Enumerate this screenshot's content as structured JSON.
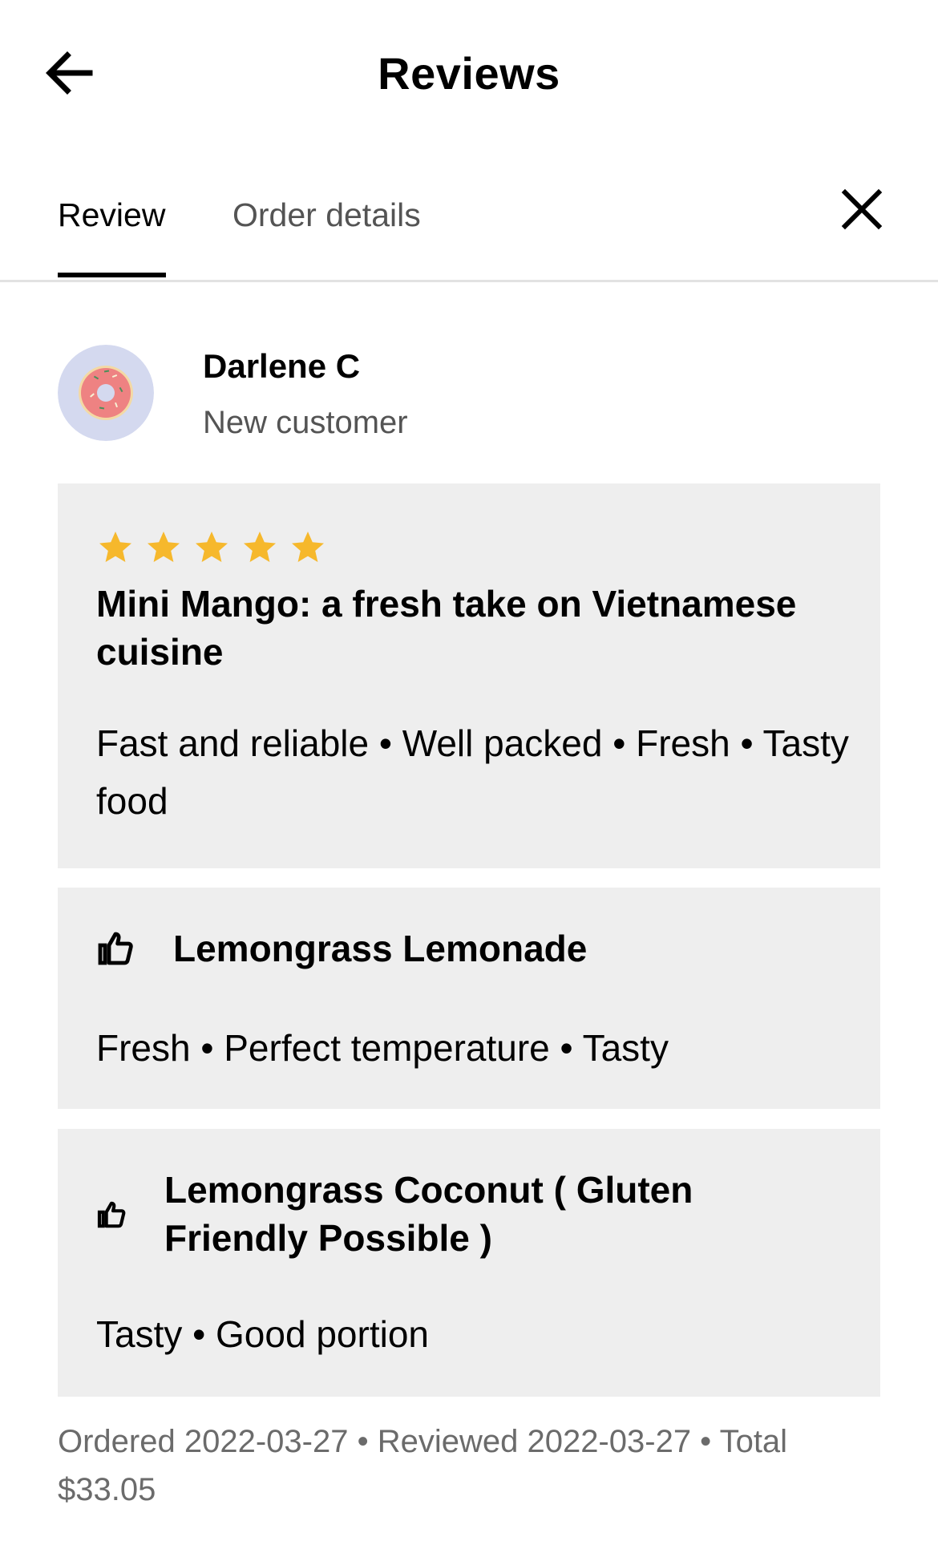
{
  "header": {
    "title": "Reviews",
    "back_icon": "arrow-left-icon"
  },
  "tabs": [
    {
      "label": "Review",
      "active": true
    },
    {
      "label": "Order details",
      "active": false
    }
  ],
  "close_icon": "close-icon",
  "reviewer": {
    "name": "Darlene C",
    "subtitle": "New customer",
    "avatar_icon": "donut-avatar-icon"
  },
  "main_review": {
    "rating": 5,
    "max_rating": 5,
    "star_color": "#F6B82C",
    "title": "Mini Mango: a fresh take on Vietnamese cuisine",
    "tags": "Fast and reliable • Well packed • Fresh • Tasty food"
  },
  "items": [
    {
      "name": "Lemongrass Lemonade",
      "icon": "thumbs-up-icon",
      "tags": "Fresh • Perfect temperature • Tasty"
    },
    {
      "name": "Lemongrass Coconut ( Gluten Friendly Possible )",
      "icon": "thumbs-up-icon",
      "tags": "Tasty • Good portion"
    }
  ],
  "footer": {
    "text": "Ordered 2022-03-27 • Reviewed 2022-03-27 • Total $33.05"
  },
  "colors": {
    "card_bg": "#EEEEEE",
    "secondary_text": "#545454",
    "footer_text": "#6B6B6B",
    "avatar_bg": "#D4D9EF",
    "donut": "#EE8282"
  }
}
